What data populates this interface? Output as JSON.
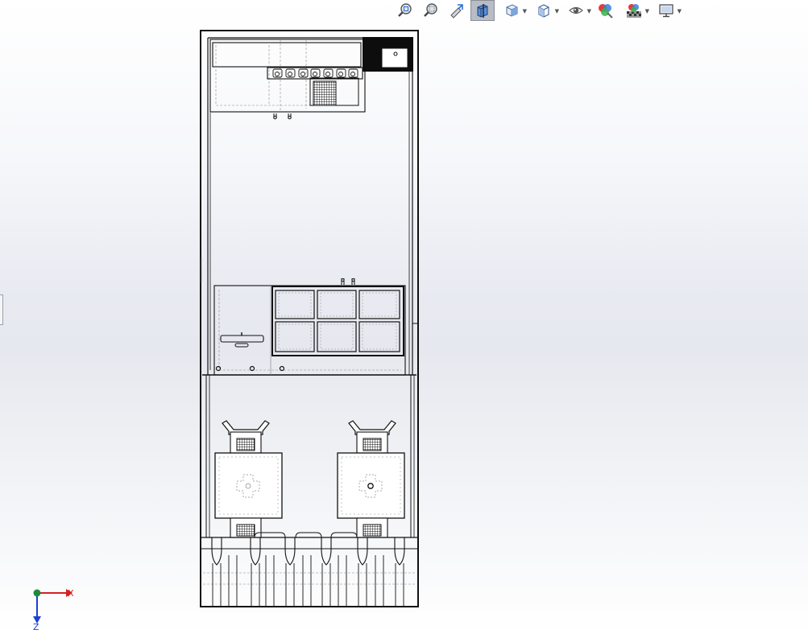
{
  "toolbar": {
    "items": [
      {
        "name": "zoom-to-fit-icon",
        "has_caret": false,
        "active": false
      },
      {
        "name": "zoom-to-area-icon",
        "has_caret": false,
        "active": false
      },
      {
        "name": "previous-view-icon",
        "has_caret": false,
        "active": false
      },
      {
        "name": "section-view-icon",
        "has_caret": false,
        "active": true
      },
      {
        "name": "view-orientation-icon",
        "has_caret": true,
        "active": false
      },
      {
        "name": "display-style-icon",
        "has_caret": true,
        "active": false
      },
      {
        "name": "hide-show-items-icon",
        "has_caret": true,
        "active": false
      },
      {
        "name": "edit-appearance-icon",
        "has_caret": false,
        "active": false
      },
      {
        "name": "apply-scene-icon",
        "has_caret": true,
        "active": false
      },
      {
        "name": "view-settings-icon",
        "has_caret": true,
        "active": false
      }
    ]
  },
  "triad": {
    "x_label": "X",
    "z_label": "Z",
    "x_color": "#d42020",
    "z_color": "#1c3fd4",
    "origin_color": "#1f8a3a"
  },
  "colors": {
    "line": "#111111",
    "hidden_line": "#8a8a8a",
    "active_button": "#b8bcc4"
  }
}
